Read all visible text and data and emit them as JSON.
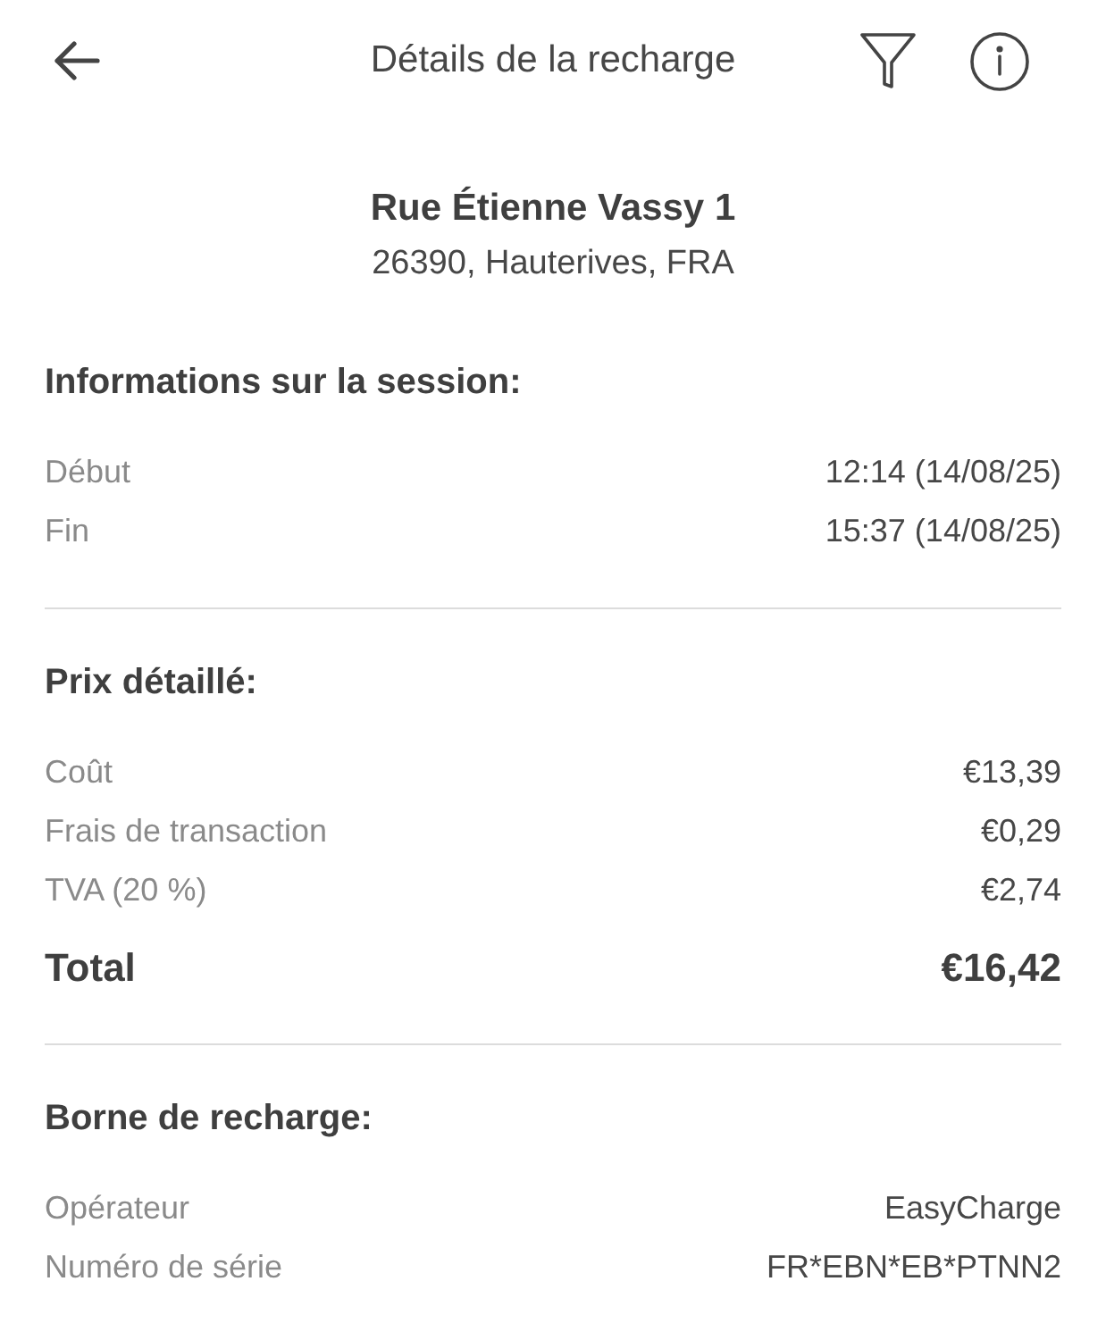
{
  "header": {
    "title": "Détails de la recharge"
  },
  "address": {
    "street": "Rue Étienne Vassy 1",
    "locality": "26390, Hauterives, FRA"
  },
  "sections": [
    {
      "heading": "Informations sur la session:",
      "rows": [
        {
          "kind": "detail",
          "label": "Début",
          "value": "12:14 (14/08/25)"
        },
        {
          "kind": "detail",
          "label": "Fin",
          "value": "15:37 (14/08/25)"
        }
      ]
    },
    {
      "heading": "Prix détaillé:",
      "rows": [
        {
          "kind": "detail",
          "label": "Coût",
          "value": "€13,39"
        },
        {
          "kind": "detail",
          "label": "Frais de transaction",
          "value": "€0,29"
        },
        {
          "kind": "detail",
          "label": "TVA (20 %)",
          "value": "€2,74"
        },
        {
          "kind": "total",
          "label": "Total",
          "value": "€16,42"
        }
      ]
    },
    {
      "heading": "Borne de recharge:",
      "rows": [
        {
          "kind": "detail",
          "label": "Opérateur",
          "value": "EasyCharge"
        },
        {
          "kind": "detail",
          "label": "Numéro de série",
          "value": "FR*EBN*EB*PTNN2"
        }
      ]
    }
  ]
}
